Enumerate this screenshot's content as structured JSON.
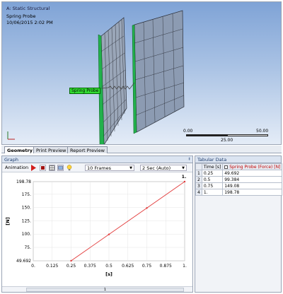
{
  "viewport": {
    "title": "A: Static Structural",
    "subtitle": "Spring Probe",
    "datetime": "10/06/2015 2:02 PM",
    "probe_label": "Spring Probe",
    "scale": {
      "t0": "0.00",
      "t1": "25.00",
      "t2": "50.00"
    }
  },
  "tabs": [
    {
      "label": "Geometry"
    },
    {
      "label": "Print Preview"
    },
    {
      "label": "Report Preview"
    }
  ],
  "graph": {
    "panel_title": "Graph",
    "animation_label": "Animation",
    "frames_label": "10 Frames",
    "time_label": "2 Sec (Auto)",
    "footer_value": "1"
  },
  "chart_data": {
    "type": "line",
    "x": [
      0.25,
      0.5,
      0.75,
      1.0
    ],
    "y": [
      49.692,
      99.384,
      149.08,
      198.78
    ],
    "xlim": [
      0,
      1
    ],
    "ylim": [
      49.692,
      198.78
    ],
    "xlabel": "[s]",
    "ylabel": "[N]",
    "x_ticks": [
      "0.",
      "0.125",
      "0.25",
      "0.375",
      "0.5",
      "0.625",
      "0.75",
      "0.875",
      "1."
    ],
    "y_ticks": [
      "49.692",
      "75.",
      "100.",
      "125.",
      "150.",
      "175.",
      "198.78"
    ],
    "annotation": "1.",
    "line_color": "#e23b3b",
    "grid": true
  },
  "table": {
    "panel_title": "Tabular Data",
    "headers": [
      "Time [s]",
      "Spring Probe (Force) [N]"
    ],
    "rows": [
      {
        "n": "1",
        "time": "0.25",
        "force": "49.692"
      },
      {
        "n": "2",
        "time": "0.5",
        "force": "99.384"
      },
      {
        "n": "3",
        "time": "0.75",
        "force": "149.08"
      },
      {
        "n": "4",
        "time": "1.",
        "force": "198.78"
      }
    ]
  }
}
